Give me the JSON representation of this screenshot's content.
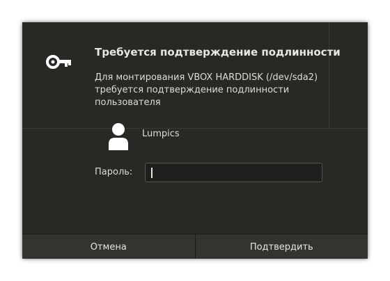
{
  "dialog": {
    "title": "Требуется подтверждение подлинности",
    "message_lines": [
      "Для монтирования VBOX HARDDISK (/dev/sda2)",
      "требуется подтверждение подлинности",
      "пользователя"
    ],
    "icon": "key-icon"
  },
  "user": {
    "name": "Lumpics",
    "avatar_icon": "user-avatar-icon"
  },
  "password": {
    "label": "Пароль:",
    "value": ""
  },
  "buttons": {
    "cancel_label": "Отмена",
    "confirm_label": "Подтвердить"
  },
  "colors": {
    "dialog_bg": "#2a2825",
    "button_bg": "#353330",
    "text": "#e6e6e3"
  }
}
